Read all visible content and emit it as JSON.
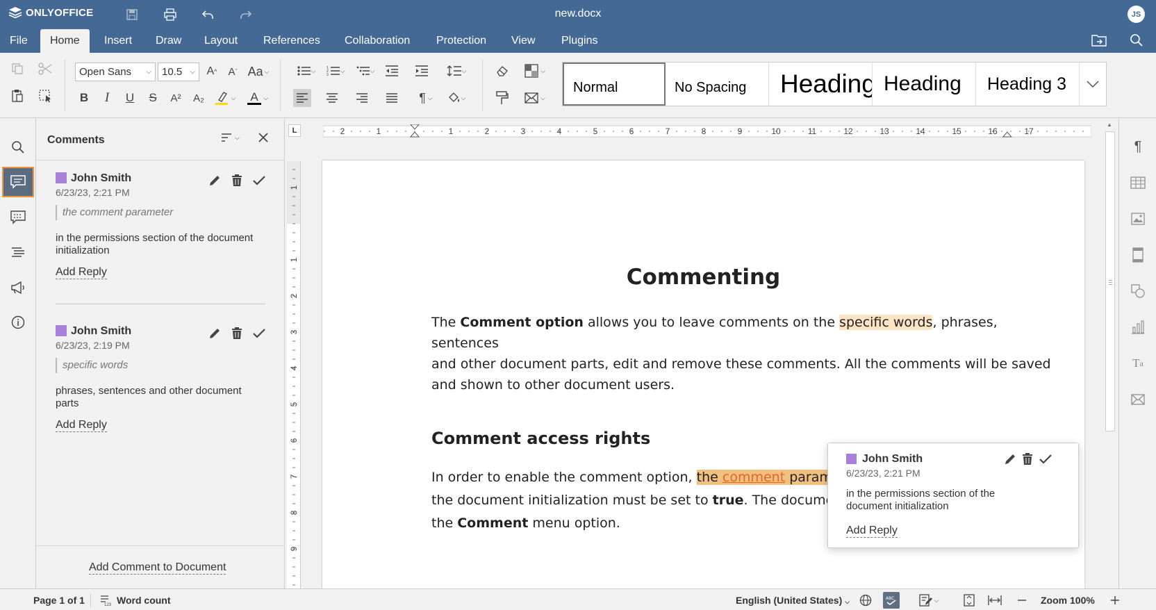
{
  "app": {
    "name": "ONLYOFFICE",
    "document_title": "new.docx",
    "user_initials": "JS"
  },
  "menu": {
    "tabs": [
      "File",
      "Home",
      "Insert",
      "Draw",
      "Layout",
      "References",
      "Collaboration",
      "Protection",
      "View",
      "Plugins"
    ],
    "active": "Home"
  },
  "toolbar": {
    "font_name": "Open Sans",
    "font_size": "10.5",
    "case_label": "Aa",
    "bold": "B",
    "italic": "I",
    "underline": "U",
    "strike": "S",
    "superscript": "A²",
    "subscript": "A₂",
    "font_color_label": "A",
    "styles": [
      "Normal",
      "No Spacing",
      "Heading",
      "Heading",
      "Heading 3"
    ],
    "highlight_color": "#ffd700",
    "font_color": "#000000"
  },
  "comments_panel": {
    "title": "Comments",
    "comments": [
      {
        "author": "John Smith",
        "date": "6/23/23, 2:21 PM",
        "quote": "the comment parameter",
        "text": "in the permissions section of the document initialization",
        "reply_label": "Add Reply"
      },
      {
        "author": "John Smith",
        "date": "6/23/23, 2:19 PM",
        "quote": "specific words",
        "text": "phrases, sentences and other document parts",
        "reply_label": "Add Reply"
      }
    ],
    "footer_label": "Add Comment to Document",
    "author_color": "#a87fd9"
  },
  "ruler": {
    "h_labels": [
      "2",
      "1",
      "1",
      "2",
      "3",
      "4",
      "5",
      "6",
      "7",
      "8",
      "9",
      "10",
      "11",
      "12",
      "13",
      "14",
      "15",
      "16",
      "17"
    ],
    "v_labels": [
      "1",
      "1",
      "2",
      "3",
      "4",
      "5",
      "6",
      "7",
      "8",
      "9"
    ]
  },
  "document": {
    "heading1": "Commenting",
    "para1": {
      "p1": "The ",
      "b1": "Comment option",
      "p2": " allows you to leave comments on the ",
      "hl": "specific words",
      "p3": ", phrases, sentences",
      "line2": "and other document parts, edit and remove these comments. All the comments will be saved",
      "line3": "and shown to other document users."
    },
    "heading2": "Comment access rights",
    "para2": {
      "p1": "In order to enable the comment option, ",
      "hl_a": "the ",
      "hl_link": "comment",
      "hl_b": " paramete",
      "line2a": "the document initialization must be set to ",
      "b1": "true",
      "line2b": ". The document s",
      "line3a": "the ",
      "b2": "Comment",
      "line3b": " menu option."
    }
  },
  "popup": {
    "author": "John Smith",
    "date": "6/23/23, 2:21 PM",
    "text": "in the permissions section of the document initialization",
    "reply_label": "Add Reply"
  },
  "status": {
    "page": "Page 1 of 1",
    "word_count": "Word count",
    "language": "English (United States)",
    "zoom": "Zoom 100%"
  },
  "colors": {
    "header": "#446995",
    "accent": "#f0943e",
    "highlight": "#fde4c5",
    "highlight_active": "#f0c080",
    "link": "#e8632e"
  }
}
